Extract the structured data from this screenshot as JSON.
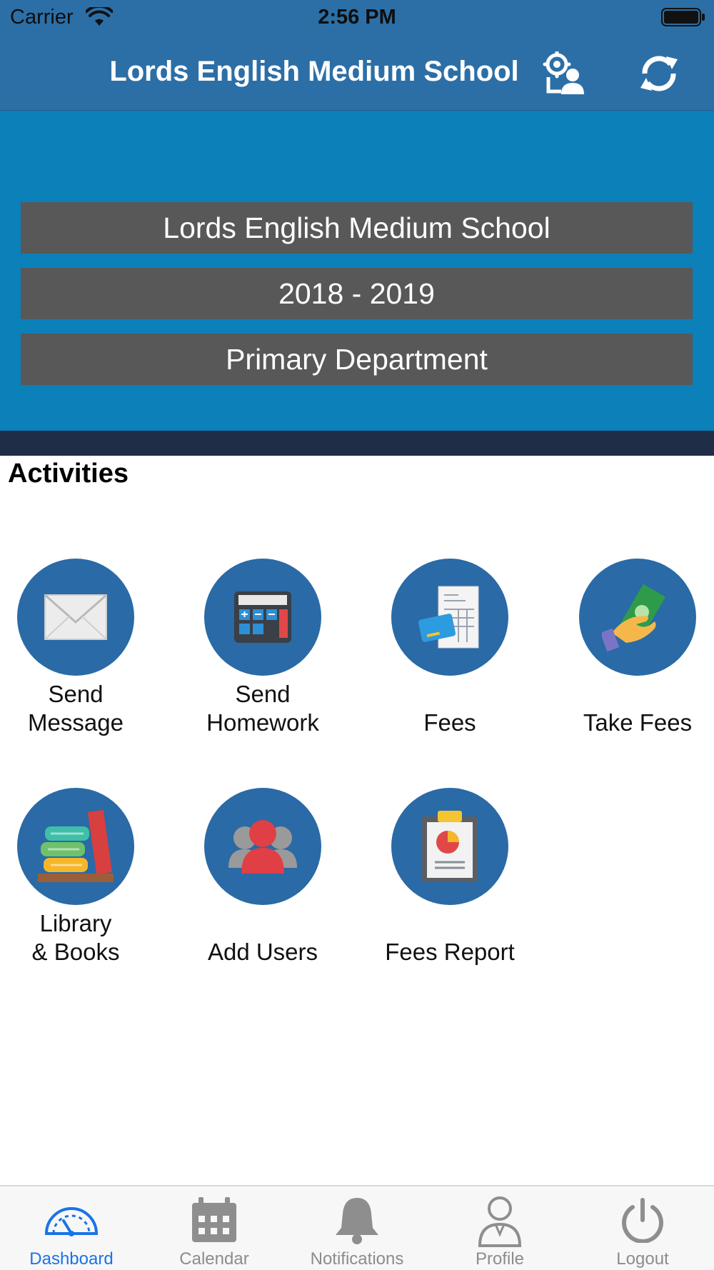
{
  "status_bar": {
    "carrier": "Carrier",
    "time": "2:56 PM"
  },
  "nav": {
    "title": "Lords English Medium School",
    "icons": [
      "user-settings-icon",
      "refresh-icon"
    ]
  },
  "banner": {
    "school": "Lords English Medium School",
    "year": "2018 - 2019",
    "department": "Primary Department"
  },
  "activities": {
    "title": "Activities",
    "items": [
      {
        "label": "Send\nMessage",
        "icon": "envelope-icon"
      },
      {
        "label": "Send\nHomework",
        "icon": "calculator-icon"
      },
      {
        "label": "Fees",
        "icon": "invoice-card-icon"
      },
      {
        "label": "Take Fees",
        "icon": "cash-hand-icon"
      },
      {
        "label": "Library\n& Books",
        "icon": "books-icon"
      },
      {
        "label": "Add Users",
        "icon": "users-icon"
      },
      {
        "label": "Fees Report",
        "icon": "report-clipboard-icon"
      }
    ]
  },
  "tabs": [
    {
      "label": "Dashboard",
      "icon": "speedometer-icon",
      "active": true
    },
    {
      "label": "Calendar",
      "icon": "calendar-icon"
    },
    {
      "label": "Notifications",
      "icon": "bell-icon"
    },
    {
      "label": "Profile",
      "icon": "person-icon"
    },
    {
      "label": "Logout",
      "icon": "power-icon"
    }
  ],
  "colors": {
    "nav": "#2c6fa6",
    "banner": "#0b80b9",
    "bar": "#585858",
    "circle": "#2a6aa6",
    "active_tab": "#1a73e8"
  }
}
